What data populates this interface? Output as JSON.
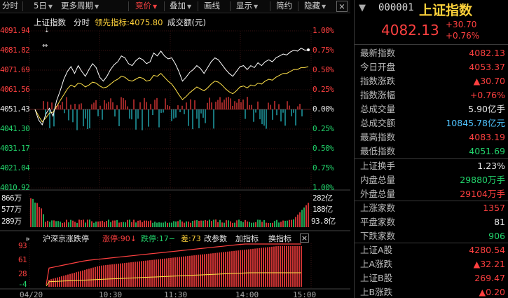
{
  "toolbar": {
    "items": [
      {
        "label": "分时"
      },
      {
        "label": "5日"
      },
      {
        "label": "更多周期"
      },
      {
        "label": "竞价"
      },
      {
        "label": "叠加"
      },
      {
        "label": "画线"
      },
      {
        "label": "显示"
      },
      {
        "label": "简约"
      },
      {
        "label": "隐藏"
      }
    ],
    "close_glyph": "×"
  },
  "chart_header": {
    "index_name": "上证指数",
    "mode": "分时",
    "leading_label": "领先指标:4075.80",
    "turnover_label": "成交额(元)"
  },
  "price_axis": {
    "left": [
      "4091.94",
      "4081.82",
      "4071.69",
      "4061.56",
      "4051.43",
      "4041.30",
      "4031.17",
      "4021.04",
      "4010.92"
    ],
    "right": [
      "1.00%",
      "0.75%",
      "0.50%",
      "0.25%",
      "0.00%",
      "0.25%",
      "0.50%",
      "0.75%",
      "1.00%"
    ]
  },
  "volume_axis": {
    "left": [
      "866万",
      "577万",
      "289万"
    ],
    "right": [
      "282亿",
      "188亿",
      "93.8亿"
    ]
  },
  "limit_panel": {
    "title": "沪深京涨跌停",
    "up_label": "涨停:90",
    "down_label": "跌停:17",
    "diff_label": "差:73",
    "param_btn": "改参数",
    "add_btn": "加指标",
    "switch_btn": "换指标",
    "close_glyph": "×",
    "y_axis": [
      "93",
      "61",
      "28",
      "-4"
    ]
  },
  "x_axis": {
    "date": "04/20",
    "ticks": [
      "10:30",
      "11:30",
      "14:00",
      "15:00"
    ]
  },
  "colors": {
    "up": "#ff4040",
    "down": "#22d36b",
    "price_line": "#ffffff",
    "avg_line": "#ffe24a",
    "flat_bar": "#29c6d0",
    "accent_title": "#ffd23a"
  },
  "quote": {
    "code": "000001",
    "name": "上证指数",
    "price": "4082.13",
    "change": "+30.70",
    "change_pct": "+0.76%"
  },
  "stats": [
    {
      "label": "最新指数",
      "value": "4082.13",
      "color": "red"
    },
    {
      "label": "今日开盘",
      "value": "4053.37",
      "color": "red"
    },
    {
      "label": "指数涨跌",
      "value": "▲30.70",
      "color": "red"
    },
    {
      "label": "指数涨幅",
      "value": "+0.76%",
      "color": "red"
    },
    {
      "label": "总成交量",
      "value": "5.90亿手",
      "color": "white"
    },
    {
      "label": "总成交额",
      "value": "10845.78亿元",
      "color": "blue"
    },
    {
      "label": "最高指数",
      "value": "4083.19",
      "color": "red"
    },
    {
      "label": "最低指数",
      "value": "4051.69",
      "color": "green"
    },
    {
      "label": "上证换手",
      "value": "1.23%",
      "color": "white"
    },
    {
      "label": "内盘总量",
      "value": "29880万手",
      "color": "green"
    },
    {
      "label": "外盘总量",
      "value": "29104万手",
      "color": "red"
    },
    {
      "label": "上涨家数",
      "value": "1357",
      "color": "red"
    },
    {
      "label": "平盘家数",
      "value": "81",
      "color": "white"
    },
    {
      "label": "下跌家数",
      "value": "906",
      "color": "green"
    },
    {
      "label": "上证A股",
      "value": "4280.54",
      "color": "red"
    },
    {
      "label": "上A涨跌",
      "value": "▲32.21",
      "color": "red"
    },
    {
      "label": "上证B股",
      "value": "269.47",
      "color": "red"
    },
    {
      "label": "上B涨跌",
      "value": "▲0.20",
      "color": "red"
    }
  ],
  "chart_data": {
    "type": "line",
    "prev_close": 4051.43,
    "ylim": [
      4010.92,
      4091.94
    ],
    "series": [
      {
        "values": [
          4051.4,
          4046.0,
          4043.5,
          4049.0,
          4052.0,
          4048.0,
          4056.0,
          4061.0,
          4067.0,
          4071.0,
          4073.5,
          4070.0,
          4074.0,
          4071.0,
          4068.5,
          4072.0,
          4075.0,
          4073.0,
          4068.0,
          4066.0,
          4068.5,
          4072.0,
          4074.5,
          4076.0,
          4079.0,
          4078.0,
          4075.0,
          4074.0,
          4076.5,
          4078.0,
          4077.0,
          4075.0,
          4076.0,
          4080.5,
          4079.0,
          4081.5,
          4079.0,
          4077.5,
          4078.0,
          4075.0,
          4071.0,
          4066.0,
          4068.0,
          4070.5,
          4072.0,
          4074.0,
          4072.5,
          4070.0,
          4073.0,
          4076.0,
          4078.0,
          4077.0,
          4074.5,
          4072.0,
          4070.0,
          4068.5,
          4071.0,
          4073.5,
          4074.0,
          4072.0,
          4074.0,
          4073.0,
          4075.5,
          4074.0,
          4076.0,
          4077.0,
          4076.0,
          4078.0,
          4079.0,
          4080.0,
          4079.5,
          4081.0,
          4082.0,
          4081.5,
          4083.0,
          4082.0,
          4082.13
        ]
      },
      {
        "values": [
          4051.4,
          4048.0,
          4045.0,
          4047.0,
          4049.5,
          4050.0,
          4053.0,
          4056.0,
          4059.0,
          4062.0,
          4064.0,
          4063.0,
          4065.0,
          4064.5,
          4063.0,
          4064.0,
          4065.5,
          4065.0,
          4063.5,
          4062.5,
          4063.0,
          4064.5,
          4066.0,
          4067.0,
          4068.5,
          4068.0,
          4066.5,
          4066.0,
          4067.0,
          4068.0,
          4067.5,
          4066.0,
          4066.5,
          4069.0,
          4068.5,
          4070.0,
          4068.0,
          4066.0,
          4064.5,
          4062.0,
          4059.0,
          4056.5,
          4058.0,
          4060.0,
          4061.5,
          4063.0,
          4062.0,
          4061.0,
          4062.5,
          4064.5,
          4066.0,
          4065.5,
          4064.0,
          4062.0,
          4060.5,
          4059.5,
          4061.0,
          4063.0,
          4063.5,
          4062.5,
          4064.0,
          4063.5,
          4065.0,
          4064.5,
          4066.0,
          4067.0,
          4066.5,
          4068.0,
          4069.0,
          4070.0,
          4070.0,
          4071.0,
          4072.0,
          4072.0,
          4073.0,
          4073.0,
          4073.5
        ]
      }
    ]
  }
}
